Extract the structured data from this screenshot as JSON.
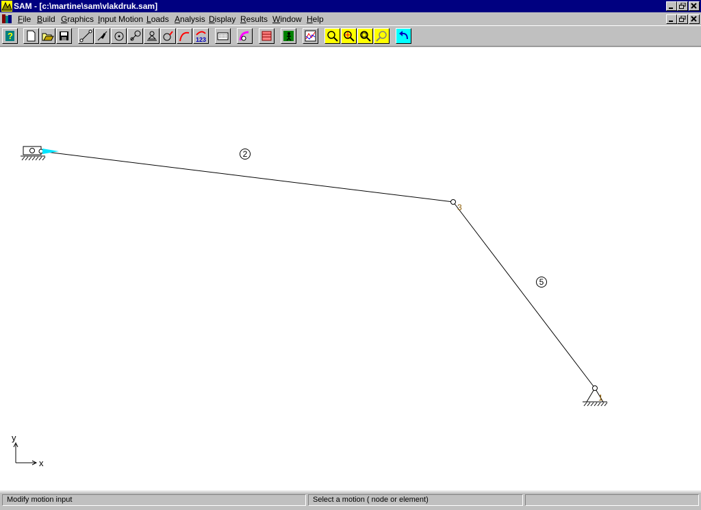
{
  "window": {
    "title": "SAM - [c:\\martine\\sam\\vlakdruk.sam]"
  },
  "menu": [
    {
      "label": "File",
      "underline": "F",
      "rest": "ile"
    },
    {
      "label": "Build",
      "underline": "B",
      "rest": "uild"
    },
    {
      "label": "Graphics",
      "underline": "G",
      "rest": "raphics"
    },
    {
      "label": "Input Motion",
      "underline": "I",
      "rest": "nput Motion"
    },
    {
      "label": "Loads",
      "underline": "L",
      "rest": "oads"
    },
    {
      "label": "Analysis",
      "underline": "A",
      "rest": "nalysis"
    },
    {
      "label": "Display",
      "underline": "D",
      "rest": "isplay"
    },
    {
      "label": "Results",
      "underline": "R",
      "rest": "esults"
    },
    {
      "label": "Window",
      "underline": "W",
      "rest": "indow"
    },
    {
      "label": "Help",
      "underline": "H",
      "rest": "elp"
    }
  ],
  "toolbar": {
    "buttons": [
      "help-icon",
      "new-file-icon",
      "open-folder-icon",
      "save-icon",
      "beam-element-icon",
      "slider-element-icon",
      "hinge-element-icon",
      "gear-element-icon",
      "spring-element-icon",
      "cam-element-icon",
      "curve-element-icon",
      "numbering-icon",
      "keyboard-icon",
      "input-motion-icon",
      "analysis-icon",
      "run-icon",
      "plot-results-icon",
      "zoom-out-icon",
      "zoom-center-icon",
      "zoom-window-icon",
      "zoom-fit-icon",
      "undo-icon"
    ],
    "numbering_text": "123"
  },
  "drawing": {
    "nodes": {
      "n3": "3",
      "n1": "1"
    },
    "elements": {
      "e2": "2",
      "e5": "5"
    },
    "axis": {
      "x": "x",
      "y": "y"
    },
    "colors": {
      "line": "#000000",
      "node_label": "#8b5a00",
      "motion_arrow": "#00e5ff"
    }
  },
  "status": {
    "left": "Modify motion input",
    "middle": "Select a motion ( node or element)",
    "right": ""
  }
}
